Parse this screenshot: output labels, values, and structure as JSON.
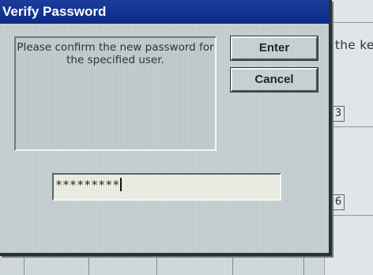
{
  "window": {
    "title": "Verify Password"
  },
  "dialog": {
    "message": "Please confirm the new password for the specified user.",
    "enter_label": "Enter",
    "cancel_label": "Cancel",
    "password_value": "*********"
  },
  "background": {
    "partial_text": "the ke",
    "box_label_1": "3",
    "box_label_2": "6"
  },
  "colors": {
    "titlebar": "#0b2a87",
    "dialog_bg": "#c7d1d4",
    "field_bg": "#eceee3"
  }
}
